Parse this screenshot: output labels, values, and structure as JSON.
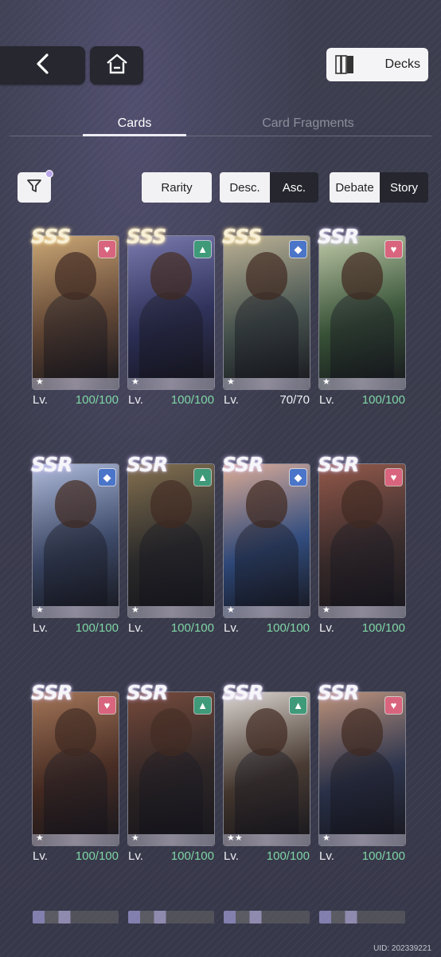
{
  "top_bar": {
    "back_icon": "chevron-left-icon",
    "home_icon": "home-icon",
    "decks_icon": "decks-icon",
    "decks_label": "Decks"
  },
  "tabs": [
    {
      "label": "Cards",
      "active": true
    },
    {
      "label": "Card Fragments",
      "active": false
    }
  ],
  "toolbar": {
    "filter_icon": "filter-icon",
    "sort_label": "Rarity",
    "order": {
      "desc_label": "Desc.",
      "asc_label": "Asc.",
      "selected": "Desc."
    },
    "mode": {
      "debate_label": "Debate",
      "story_label": "Story",
      "selected": "Debate"
    }
  },
  "colors": {
    "pink_badge": "#d9647d",
    "green_badge": "#3f9a7a",
    "blue_badge": "#4b75c9",
    "level_green": "#7fd6a6"
  },
  "cards": [
    {
      "rarity": "SSS",
      "badge": "heart",
      "stars": "★",
      "lv": "Lv.",
      "level": "100/100",
      "c1": "#6b4a35",
      "c2": "#c7a06a"
    },
    {
      "rarity": "SSS",
      "badge": "triangle",
      "stars": "★",
      "lv": "Lv.",
      "level": "100/100",
      "c1": "#2c2f5f",
      "c2": "#6f6fa8"
    },
    {
      "rarity": "SSS",
      "badge": "diamond",
      "stars": "★",
      "lv": "Lv.",
      "level": "70/70",
      "c1": "#4b5a55",
      "c2": "#b7ab8c"
    },
    {
      "rarity": "SSR",
      "badge": "heart",
      "stars": "★",
      "lv": "Lv.",
      "level": "100/100",
      "c1": "#3a5a3a",
      "c2": "#b9c4a0"
    },
    {
      "rarity": "SSR",
      "badge": "diamond",
      "stars": "★",
      "lv": "Lv.",
      "level": "100/100",
      "c1": "#3c4b6f",
      "c2": "#aab6d8"
    },
    {
      "rarity": "SSR",
      "badge": "triangle",
      "stars": "★",
      "lv": "Lv.",
      "level": "100/100",
      "c1": "#2a2a2a",
      "c2": "#7a6440"
    },
    {
      "rarity": "SSR",
      "badge": "diamond",
      "stars": "★",
      "lv": "Lv.",
      "level": "100/100",
      "c1": "#2f4f8a",
      "c2": "#d9a48b"
    },
    {
      "rarity": "SSR",
      "badge": "heart",
      "stars": "★",
      "lv": "Lv.",
      "level": "100/100",
      "c1": "#3a2a2a",
      "c2": "#8a4a3a"
    },
    {
      "rarity": "SSR",
      "badge": "heart",
      "stars": "★",
      "lv": "Lv.",
      "level": "100/100",
      "c1": "#4a2a1f",
      "c2": "#9c6a4a"
    },
    {
      "rarity": "SSR",
      "badge": "triangle",
      "stars": "★",
      "lv": "Lv.",
      "level": "100/100",
      "c1": "#2b2222",
      "c2": "#6b3a2a"
    },
    {
      "rarity": "SSR",
      "badge": "triangle",
      "stars": "★★",
      "lv": "Lv.",
      "level": "100/100",
      "c1": "#4a3a30",
      "c2": "#d8d2cc"
    },
    {
      "rarity": "SSR",
      "badge": "heart",
      "stars": "★",
      "lv": "Lv.",
      "level": "100/100",
      "c1": "#2a3350",
      "c2": "#b98a6f"
    }
  ],
  "uid_text": "UID: 202339221"
}
